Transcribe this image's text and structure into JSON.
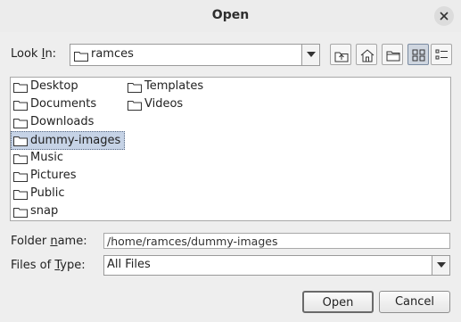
{
  "dialog": {
    "title": "Open",
    "close_icon": "close-icon"
  },
  "look_in": {
    "label_pre": "Look ",
    "label_mnemonic": "I",
    "label_post": "n:",
    "value": "ramces"
  },
  "toolbar": {
    "buttons": [
      "up-one-level-icon",
      "home-icon",
      "new-folder-icon",
      "list-view-icon",
      "details-view-icon"
    ],
    "active": "list-view-icon"
  },
  "files": {
    "column1": [
      "Desktop",
      "Documents",
      "Downloads",
      "dummy-images",
      "Music",
      "Pictures",
      "Public",
      "snap"
    ],
    "column2": [
      "Templates",
      "Videos"
    ],
    "selected": "dummy-images"
  },
  "folder_name": {
    "label_pre": "Folder ",
    "label_mnemonic": "n",
    "label_post": "ame:",
    "value": "/home/ramces/dummy-images"
  },
  "file_type": {
    "label_pre": "Files of ",
    "label_mnemonic": "T",
    "label_post": "ype:",
    "value": "All Files"
  },
  "actions": {
    "open": "Open",
    "cancel": "Cancel"
  }
}
